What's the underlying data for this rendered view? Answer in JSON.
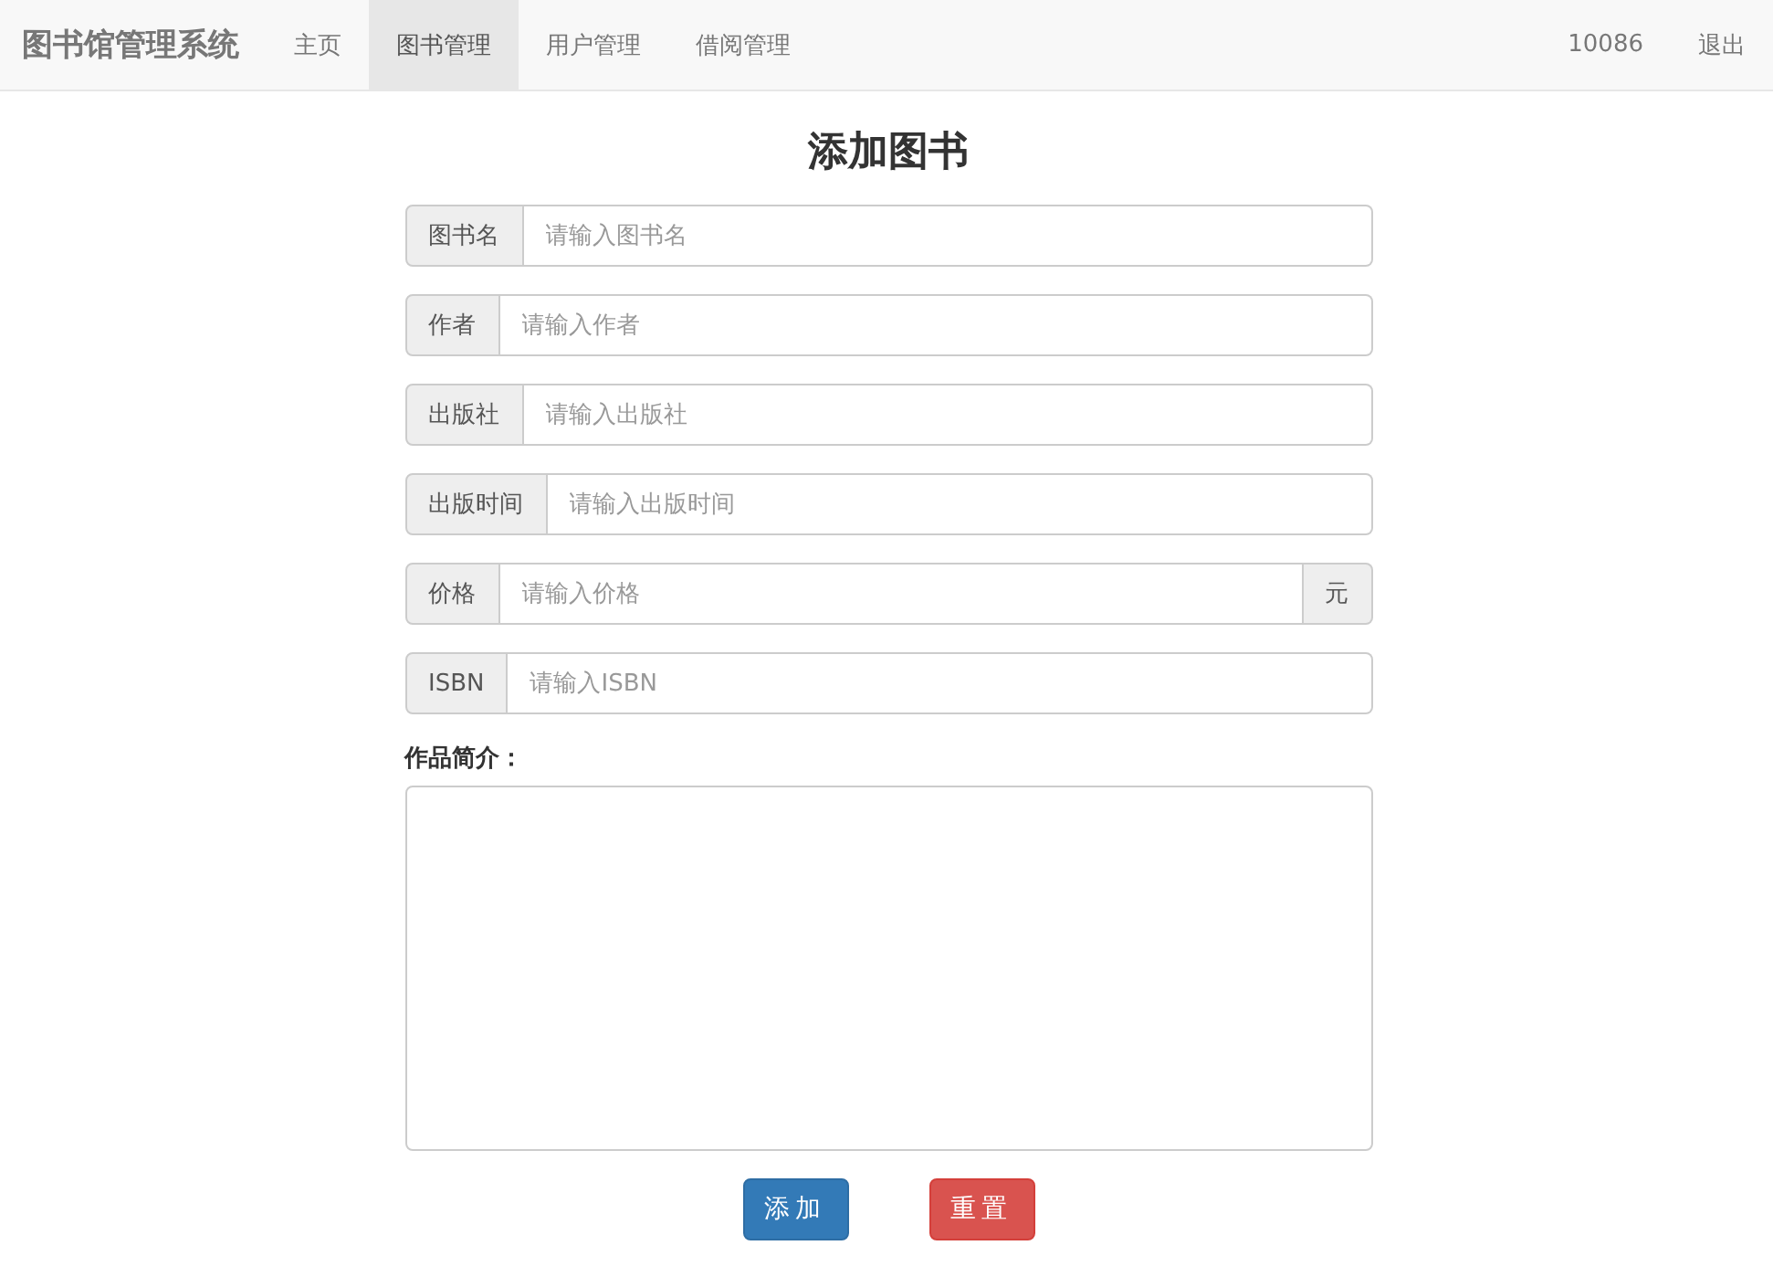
{
  "navbar": {
    "brand": "图书馆管理系统",
    "items": [
      {
        "label": "主页",
        "selected": false
      },
      {
        "label": "图书管理",
        "selected": true
      },
      {
        "label": "用户管理",
        "selected": false
      },
      {
        "label": "借阅管理",
        "selected": false
      }
    ],
    "right_items": [
      "10086",
      "退出"
    ]
  },
  "form": {
    "title": "添加图书",
    "fields": [
      {
        "label": "图书名",
        "placeholder": "请输入图书名"
      },
      {
        "label": "作者",
        "placeholder": "请输入作者"
      },
      {
        "label": "出版社",
        "placeholder": "请输入出版社"
      },
      {
        "label": "出版时间",
        "placeholder": "请输入出版时间"
      },
      {
        "label": "价格",
        "placeholder": "请输入价格",
        "suffix": "元"
      },
      {
        "label": "ISBN",
        "placeholder": "请输入ISBN"
      }
    ],
    "textarea_label": "作品简介：",
    "buttons": [
      {
        "label": "添加",
        "kind": "primary"
      },
      {
        "label": "重置",
        "kind": "danger"
      }
    ]
  }
}
